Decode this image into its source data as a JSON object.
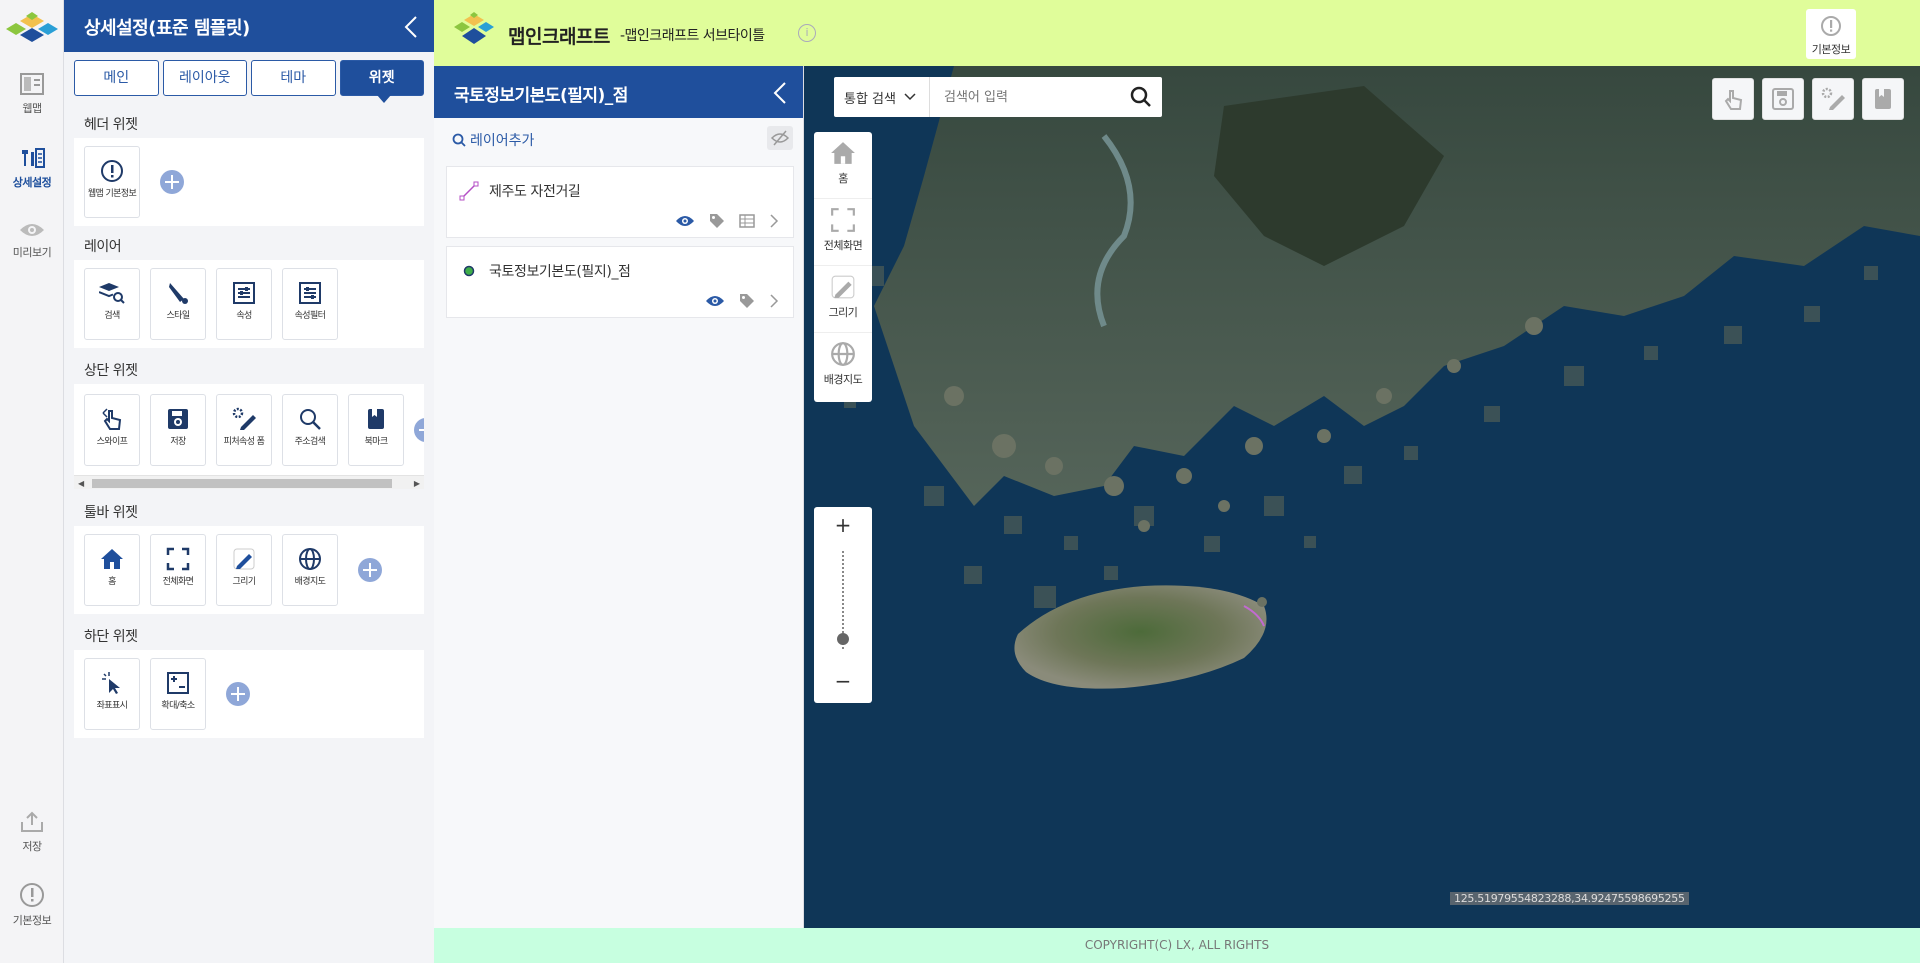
{
  "rail": {
    "items": [
      {
        "label": "웹맵"
      },
      {
        "label": "상세설정"
      },
      {
        "label": "미리보기"
      },
      {
        "label": "저장"
      },
      {
        "label": "기본정보"
      }
    ]
  },
  "settings": {
    "title": "상세설정(표준 템플릿)",
    "tabs": [
      "메인",
      "레이아웃",
      "테마",
      "위젯"
    ],
    "active_tab": "위젯",
    "header_widget": {
      "title": "헤더 위젯",
      "items": [
        "웹맵 기본정보"
      ]
    },
    "layer": {
      "title": "레이어",
      "items": [
        "검색",
        "스타일",
        "속성",
        "속성필터"
      ]
    },
    "top_widget": {
      "title": "상단 위젯",
      "items": [
        "스와이프",
        "저장",
        "피처속성 폼",
        "주소검색",
        "북마크"
      ]
    },
    "toolbar_widget": {
      "title": "툴바 위젯",
      "items": [
        "홈",
        "전체화면",
        "그리기",
        "배경지도"
      ]
    },
    "bottom_widget": {
      "title": "하단 위젯",
      "items": [
        "좌표표시",
        "확대/축소"
      ]
    }
  },
  "layers_panel": {
    "title": "국토정보기본도(필지)_점",
    "add_layer": "레이어추가",
    "items": [
      {
        "name": "제주도 자전거길"
      },
      {
        "name": "국토정보기본도(필지)_점"
      }
    ]
  },
  "topbar": {
    "title": "맵인크래프트",
    "subtitle": "-맵인크래프트 서브타이틀",
    "basic_info": "기본정보"
  },
  "map": {
    "search_type": "통합 검색",
    "search_placeholder": "검색어 입력",
    "toolbar": [
      "홈",
      "전체화면",
      "그리기",
      "배경지도"
    ],
    "zoom_in": "+",
    "zoom_out": "−",
    "zoom_level_fraction": 0.9,
    "coords": "125.51979554823288,34.92475598695255"
  },
  "footer": {
    "copyright": "COPYRIGHT(C) LX, ALL RIGHTS"
  },
  "colors": {
    "primary": "#1f4f9c",
    "topbar": "#e0fd9a",
    "footer": "#c7ffe0",
    "accent_add": "#8fa7d8"
  }
}
